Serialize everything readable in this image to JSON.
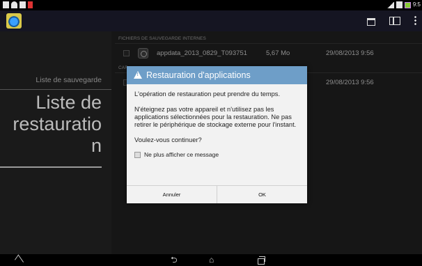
{
  "status_bar": {
    "left_icons": [
      "document-icon",
      "wifi-icon",
      "photo-icon",
      "warning-icon"
    ],
    "right_icons": [
      "signal-icon",
      "tablet-icon",
      "battery-icon"
    ],
    "time": "9:5"
  },
  "action_bar": {
    "app_icon": "backup-app-icon",
    "actions": [
      "calendar-icon",
      "columns-icon",
      "overflow-menu-icon"
    ]
  },
  "sidebar": {
    "small_label": "Liste de sauvegarde",
    "big_label_lines": [
      "Liste de",
      "restauratio",
      "n"
    ]
  },
  "list": {
    "section_internal": "FICHIERS DE SAUVEGARDE INTERNES",
    "section_card": "CAR",
    "rows": [
      {
        "name": "appdata_2013_0829_T093751",
        "size": "5,67 Mo",
        "date": "29/08/2013 9:56"
      },
      {
        "name": "",
        "size": "",
        "date": "29/08/2013 9:56"
      }
    ]
  },
  "dialog": {
    "title": "Restauration d'applications",
    "paragraph_1": "L'opération de restauration peut prendre du temps.",
    "paragraph_2": "N'éteignez pas votre appareil et n'utilisez pas les applications sélectionnées pour la restauration. Ne pas retirer le périphérique de stockage externe pour l'instant.",
    "paragraph_3": "Voulez-vous continuer?",
    "checkbox_label": "Ne plus afficher ce message",
    "cancel_label": "Annuler",
    "ok_label": "OK"
  },
  "nav_bar": {
    "back_glyph": "⮌",
    "home_glyph": "⌂"
  },
  "colors": {
    "dialog_header": "#6e9ec8",
    "background": "#222222",
    "sidebar": "#1a1a1a"
  }
}
